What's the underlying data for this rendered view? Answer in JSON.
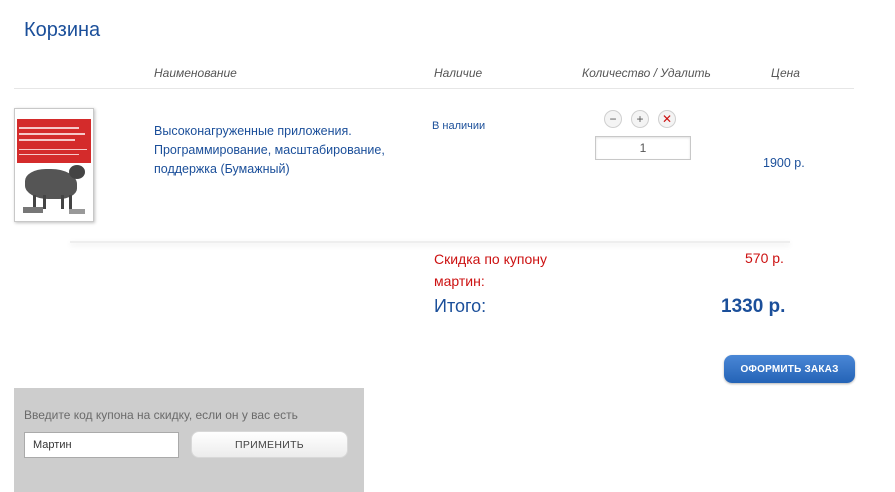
{
  "page": {
    "title": "Корзина"
  },
  "table_header": {
    "name": "Наименование",
    "availability": "Наличие",
    "quantity_remove": "Количество / Удалить",
    "price": "Цена"
  },
  "items": [
    {
      "name": "Высоконагруженные приложения. Программирование, масштабирование, поддержка (Бумажный)",
      "availability": "В наличии",
      "quantity": "1",
      "price": "1900 р.",
      "cover": {
        "icon": "book-cover-image",
        "accent_color": "#d42b2b"
      }
    }
  ],
  "quantity_controls": {
    "minus_icon": "minus-circle-icon",
    "plus_icon": "plus-circle-icon",
    "remove_icon": "close-icon",
    "minus_glyph": "−",
    "plus_glyph": "+",
    "remove_glyph": "✕"
  },
  "summary": {
    "discount_label": "Скидка по купону мартин:",
    "discount_value": "570 р.",
    "total_label": "Итого:",
    "total_value": "1330 р."
  },
  "checkout": {
    "label": "ОФОРМИТЬ ЗАКАЗ"
  },
  "coupon": {
    "hint": "Введите код купона на скидку, если он у вас есть",
    "value": "Мартин",
    "apply_label": "ПРИМЕНИТЬ"
  },
  "colors": {
    "brand_blue": "#1b4f9a",
    "discount_red": "#cc1111",
    "button_blue": "#2f6fc4",
    "panel_gray": "#cdcdcd"
  }
}
